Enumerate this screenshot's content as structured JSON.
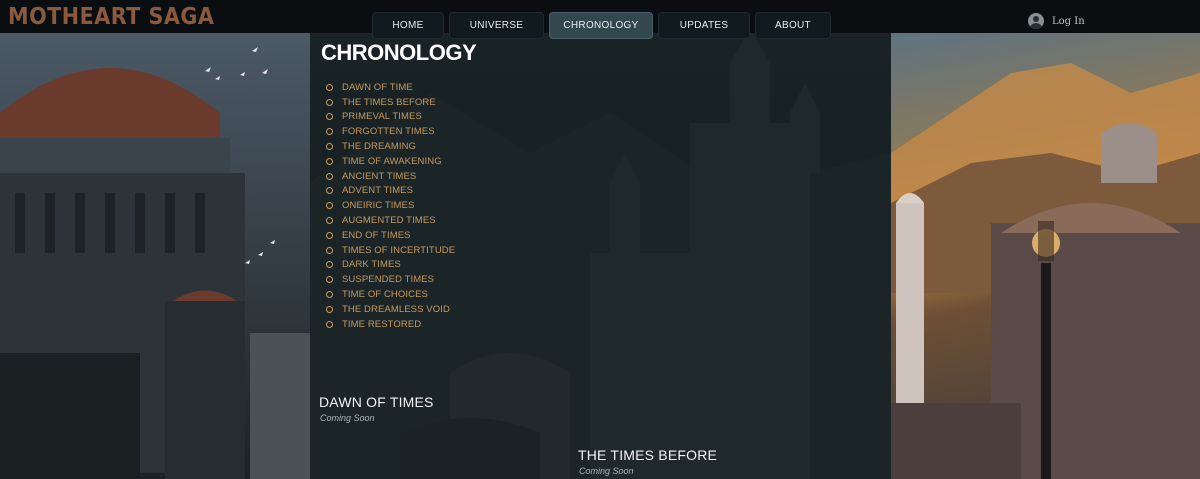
{
  "brand": "MOTHEART SAGA",
  "nav": [
    {
      "label": "HOME",
      "active": false
    },
    {
      "label": "UNIVERSE",
      "active": false
    },
    {
      "label": "CHRONOLOGY",
      "active": true
    },
    {
      "label": "UPDATES",
      "active": false
    },
    {
      "label": "ABOUT",
      "active": false
    }
  ],
  "login": {
    "label": "Log In",
    "icon": "user-avatar-icon"
  },
  "page_title": "CHRONOLOGY",
  "timeline": [
    "DAWN OF TIME",
    "THE TIMES BEFORE",
    "PRIMEVAL TIMES",
    "FORGOTTEN TIMES",
    "THE DREAMING",
    "TIME OF AWAKENING",
    "ANCIENT TIMES",
    "ADVENT TIMES",
    "ONEIRIC TIMES",
    "AUGMENTED TIMES",
    "END OF TIMES",
    "TIMES OF INCERTITUDE",
    "DARK TIMES",
    "SUSPENDED TIMES",
    "TIME OF CHOICES",
    "THE DREAMLESS VOID",
    "TIME RESTORED"
  ],
  "sections": [
    {
      "title": "DAWN OF TIMES",
      "subtitle": "Coming Soon"
    },
    {
      "title": "THE TIMES BEFORE",
      "subtitle": "Coming Soon"
    }
  ],
  "colors": {
    "accent_gold": "#c79a5f",
    "brand_copper": "#8a5a3e",
    "nav_active": "#33474f",
    "nav_bg": "#111b1f"
  }
}
